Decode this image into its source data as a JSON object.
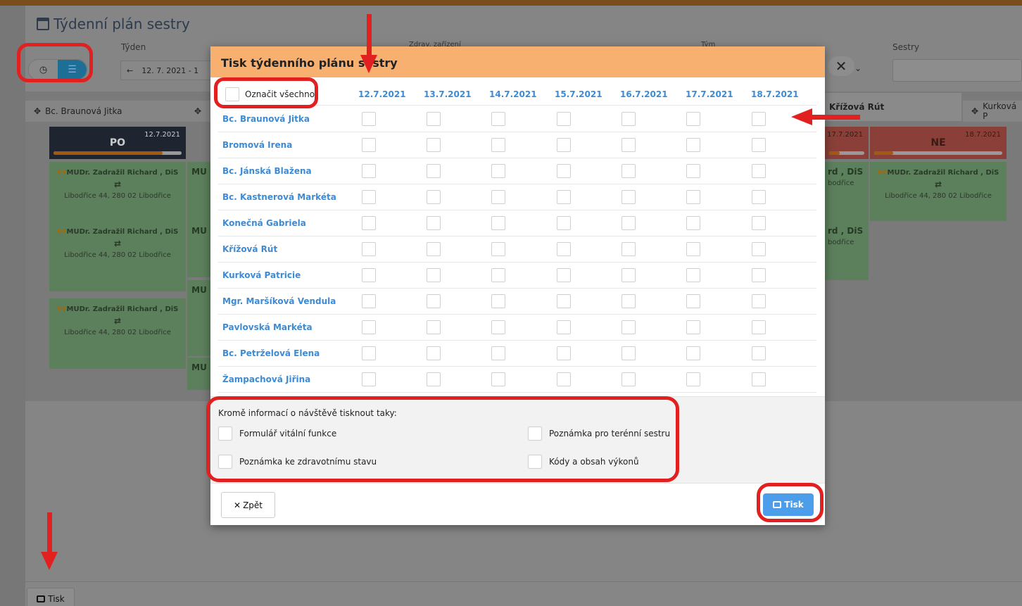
{
  "page": {
    "title": "Týdenní plán sestry",
    "labels": {
      "week": "Týden",
      "facility": "Zdrav. zařízení",
      "team": "Tým",
      "nurses": "Sestry"
    },
    "week_value": "12. 7. 2021 - 1",
    "print_button": "Tisk"
  },
  "board": {
    "columns": [
      "Bc. Braunová Jitka",
      "Křížová Rút",
      "Kurková P"
    ],
    "days": [
      {
        "label": "PO",
        "date": "12.7.2021",
        "progress": 0.85
      },
      {
        "label": "NE",
        "date": "18.7.2021",
        "progress": 0.15
      },
      {
        "label": "",
        "date": "17.7.2021",
        "progress": 0.3
      }
    ],
    "visit_num": "92",
    "visit_name": "MUDr. Zadražil Richard , DiS",
    "visit_addr": "Libodřice 44, 280 02 Libodřice",
    "visit_name_tail": "rd , DiS",
    "visit_addr_tail": "bodřice",
    "visit_short": "MU"
  },
  "modal": {
    "title": "Tisk týdenního plánu sestry",
    "select_all": "Označit všechno",
    "dates": [
      "12.7.2021",
      "13.7.2021",
      "14.7.2021",
      "15.7.2021",
      "16.7.2021",
      "17.7.2021",
      "18.7.2021"
    ],
    "nurses": [
      "Bc. Braunová Jitka",
      "Bromová Irena",
      "Bc. Jánská Blažena",
      "Bc. Kastnerová Markéta",
      "Konečná Gabriela",
      "Křížová Rút",
      "Kurková Patricie",
      "Mgr. Maršíková Vendula",
      "Pavlovská Markéta",
      "Bc. Petrželová Elena",
      "Žampachová Jiřina"
    ],
    "extras_caption": "Kromě informací o návštěvě tisknout taky:",
    "options": [
      "Formulář vitální funkce",
      "Poznámka pro terénní sestru",
      "Poznámka ke zdravotnímu stavu",
      "Kódy a obsah výkonů"
    ],
    "back_button": "Zpět",
    "print_button": "Tisk"
  },
  "colors": {
    "modal_header": "#f7b06f",
    "link_blue": "#3d8bd4",
    "highlight_red": "#e1201f",
    "print_blue": "#4d9eea"
  }
}
